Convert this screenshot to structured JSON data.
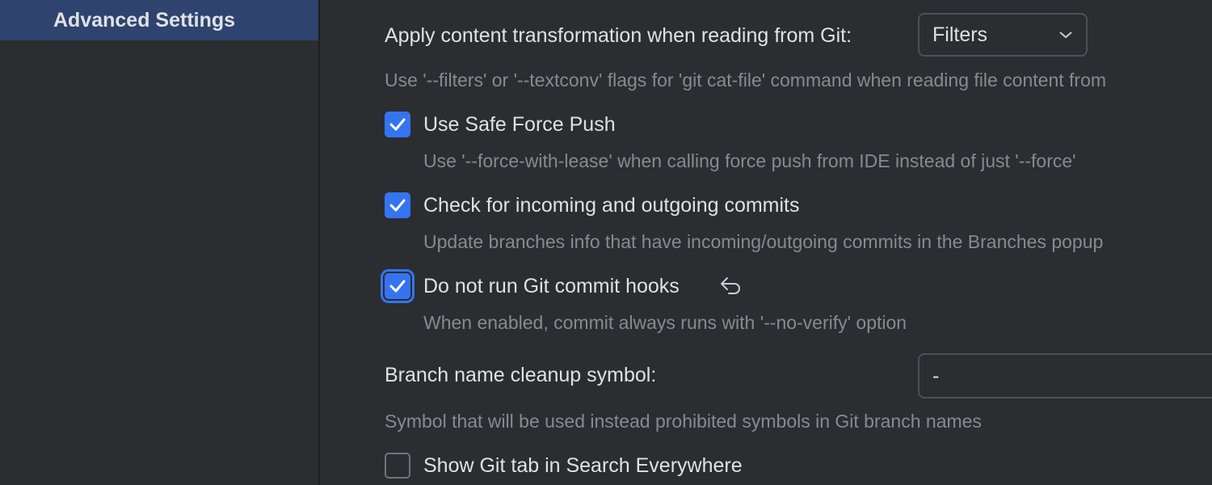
{
  "sidebar": {
    "selected_item": "Advanced Settings"
  },
  "git": {
    "content_transformation": {
      "label": "Apply content transformation when reading from Git:",
      "value": "Filters",
      "hint": "Use '--filters' or '--textconv' flags for 'git cat-file' command when reading file content from"
    },
    "safe_force_push": {
      "label": "Use Safe Force Push",
      "checked": true,
      "hint": "Use '--force-with-lease' when calling force push from IDE instead of just '--force'"
    },
    "check_commits": {
      "label": "Check for incoming and outgoing commits",
      "checked": true,
      "hint": "Update branches info that have incoming/outgoing commits in the Branches popup"
    },
    "commit_hooks": {
      "label": "Do not run Git commit hooks",
      "checked": true,
      "hint": "When enabled, commit always runs with '--no-verify' option"
    },
    "branch_cleanup": {
      "label": "Branch name cleanup symbol:",
      "value": "-",
      "hint": "Symbol that will be used instead prohibited symbols in Git branch names"
    },
    "search_everywhere": {
      "label": "Show Git tab in Search Everywhere",
      "checked": false
    }
  },
  "colors": {
    "accent": "#3574f0",
    "selection": "#2e436e",
    "background": "#2b2d30",
    "hint": "#868a91"
  }
}
